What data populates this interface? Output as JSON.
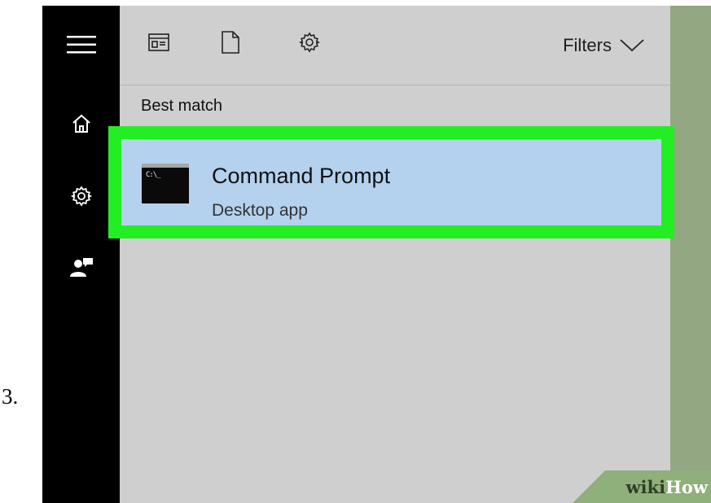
{
  "step": {
    "number": "3."
  },
  "sidebar": {
    "items": [
      {
        "icon": "hamburger-menu-icon"
      },
      {
        "icon": "home-icon"
      },
      {
        "icon": "gear-icon"
      },
      {
        "icon": "feedback-icon"
      }
    ]
  },
  "toolbar": {
    "icons": [
      "apps-icon",
      "documents-icon",
      "settings-gear-icon"
    ],
    "filters_label": "Filters"
  },
  "results": {
    "section_label": "Best match",
    "items": [
      {
        "title": "Command Prompt",
        "subtitle": "Desktop app",
        "icon_text": "C:\\_"
      }
    ]
  },
  "watermark": {
    "part1": "wiki",
    "part2": "How"
  },
  "colors": {
    "sidebar": "#000000",
    "panel": "#cfcfcf",
    "highlight": "#b4d2ee",
    "outline": "#23ee23",
    "right_strip": "#93a783"
  }
}
